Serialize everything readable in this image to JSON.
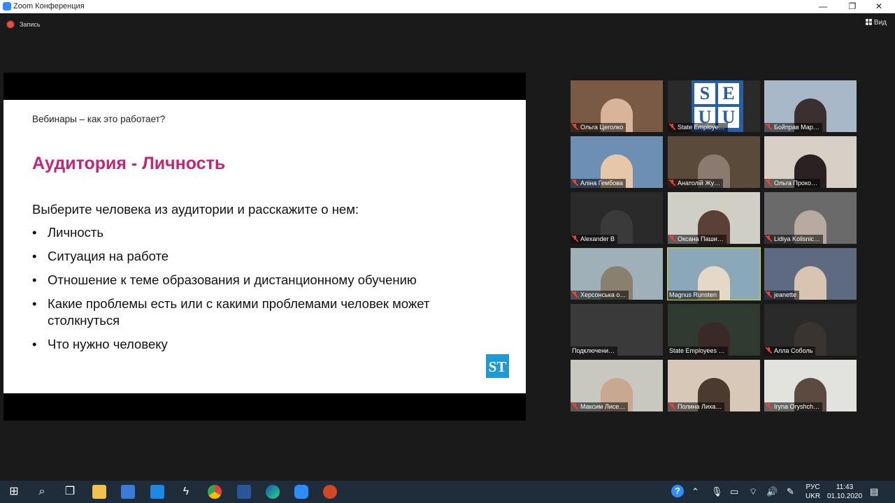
{
  "window": {
    "title": "Zoom Конференция",
    "min": "—",
    "max": "❐",
    "close": "✕"
  },
  "toolbar": {
    "recording_label": "Запись",
    "view_label": "Вид"
  },
  "slide": {
    "header": "Вебинары – как это работает?",
    "heading": "Аудитория - Личность",
    "intro": "Выберите человека из аудитории и расскажите о нем:",
    "bullets": [
      "Личность",
      "Ситуация на работе",
      "Отношение к теме образования и дистанционному обучению",
      "Какие проблемы есть или с какими проблемами человек может столкнуться",
      "Что нужно человеку"
    ],
    "bullet_char": "•",
    "logo_text": "ST"
  },
  "participants": [
    {
      "name": "Ольга Цеголко",
      "muted": true
    },
    {
      "name": "State Employe…",
      "muted": true
    },
    {
      "name": "Бойправ Мар…",
      "muted": true
    },
    {
      "name": "Аліна Гембова",
      "muted": true
    },
    {
      "name": "Анатолій Жу…",
      "muted": true
    },
    {
      "name": "Ольга Проко…",
      "muted": true
    },
    {
      "name": "Alexander B",
      "muted": true
    },
    {
      "name": "Оксана Паши…",
      "muted": true
    },
    {
      "name": "Lidiya Kolisnic…",
      "muted": true
    },
    {
      "name": "Херсонська о…",
      "muted": true
    },
    {
      "name": "Magnus Runsten",
      "muted": false,
      "active": true
    },
    {
      "name": "jeanette",
      "muted": true
    },
    {
      "name": "Подключени…",
      "muted": false
    },
    {
      "name": "State Employees …",
      "muted": false
    },
    {
      "name": "Алла Соболь",
      "muted": true
    },
    {
      "name": "Максим Лисе…",
      "muted": true
    },
    {
      "name": "Полина Лиха…",
      "muted": true
    },
    {
      "name": "Iryna Oryshch…",
      "muted": true
    }
  ],
  "seal_letters": [
    "S",
    "E",
    "U",
    "U"
  ],
  "taskbar": {
    "lang_top": "РУС",
    "lang_bottom": "UKR",
    "time": "11:43",
    "date": "01.10.2020"
  },
  "colors": {
    "accent": "#c2257a",
    "active_speaker": "#d7df4a",
    "muted": "#ff3b30",
    "zoom_blue": "#2d8cff"
  }
}
